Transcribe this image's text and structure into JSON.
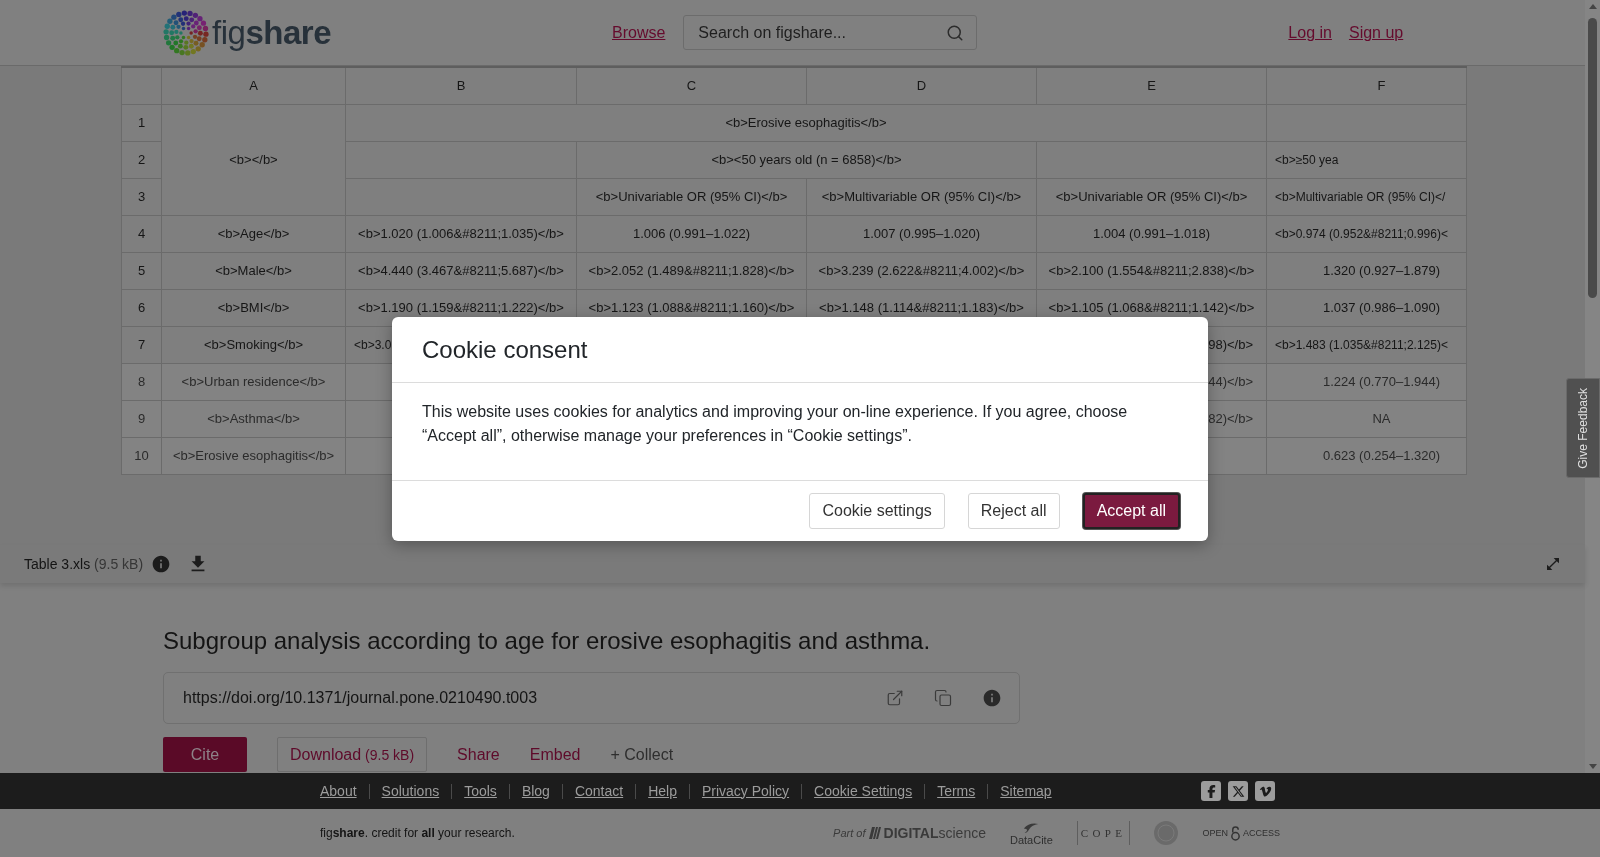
{
  "header": {
    "logo": "fig**share**",
    "nav": [
      {
        "label": "Browse"
      }
    ],
    "search": {
      "placeholder": "Search on figshare..."
    },
    "account_links": [
      {
        "label": "Log in"
      },
      {
        "label": "Sign up"
      }
    ]
  },
  "spreadsheet": {
    "columns": [
      "A",
      "B",
      "C",
      "D",
      "E",
      "F"
    ],
    "rows": [
      {
        "number": "1",
        "blurred": false,
        "cells": [
          {
            "kind": "full",
            "text": "<b></b>",
            "rowspan": 3
          },
          {
            "kind": "full",
            "text": "<b>Erosive esophagitis</b>",
            "colspan": 4
          },
          {
            "kind": "empty"
          }
        ]
      },
      {
        "number": "2",
        "blurred": false,
        "cells": [
          {
            "kind": "empty"
          },
          {
            "kind": "full",
            "text": "<b><50 years old (n = 6858)</b>",
            "colspan": 2
          },
          {
            "kind": "empty"
          },
          {
            "kind": "head",
            "text": "<b>≥50 yea"
          }
        ]
      },
      {
        "number": "3",
        "blurred": false,
        "cells": [
          {
            "kind": "empty"
          },
          {
            "kind": "full",
            "text": "<b>Univariable OR (95% CI)</b>"
          },
          {
            "kind": "full",
            "text": "<b>Multivariable OR (95% CI)</b>"
          },
          {
            "kind": "full",
            "text": "<b>Univariable OR (95% CI)</b>"
          },
          {
            "kind": "head",
            "text": "<b>Multivariable OR (95% CI)</"
          }
        ]
      },
      {
        "number": "4",
        "blurred": false,
        "cells": [
          {
            "kind": "full",
            "text": "<b>Age</b>"
          },
          {
            "kind": "full",
            "text": "<b>1.020 (1.006&#8211;1.035)</b>"
          },
          {
            "kind": "full",
            "text": "1.006 (0.991–1.022)"
          },
          {
            "kind": "full",
            "text": "1.007 (0.995–1.020)"
          },
          {
            "kind": "full",
            "text": "1.004 (0.991–1.018)"
          },
          {
            "kind": "head",
            "text": "<b>0.974 (0.952&#8211;0.996)<"
          }
        ]
      },
      {
        "number": "5",
        "blurred": false,
        "cells": [
          {
            "kind": "full",
            "text": "<b>Male</b>"
          },
          {
            "kind": "full",
            "text": "<b>4.440 (3.467&#8211;5.687)</b>"
          },
          {
            "kind": "full",
            "text": "<b>2.052 (1.489&#8211;1.828)</b>"
          },
          {
            "kind": "full",
            "text": "<b>3.239 (2.622&#8211;4.002)</b>"
          },
          {
            "kind": "full",
            "text": "<b>2.100 (1.554&#8211;2.838)</b>"
          },
          {
            "kind": "full",
            "text": "1.320 (0.927–1.879)"
          }
        ]
      },
      {
        "number": "6",
        "blurred": false,
        "cells": [
          {
            "kind": "full",
            "text": "<b>BMI</b>"
          },
          {
            "kind": "full",
            "text": "<b>1.190 (1.159&#8211;1.222)</b>"
          },
          {
            "kind": "full",
            "text": "<b>1.123 (1.088&#8211;1.160)</b>"
          },
          {
            "kind": "full",
            "text": "<b>1.148 (1.114&#8211;1.183)</b>"
          },
          {
            "kind": "full",
            "text": "<b>1.105 (1.068&#8211;1.142)</b>"
          },
          {
            "kind": "full",
            "text": "1.037 (0.986–1.090)"
          }
        ]
      },
      {
        "number": "7",
        "blurred": false,
        "cells": [
          {
            "kind": "full",
            "text": "<b>Smoking</b>"
          },
          {
            "kind": "head",
            "text": "<b>3.0"
          },
          {
            "kind": "empty"
          },
          {
            "kind": "empty"
          },
          {
            "kind": "tail",
            "text": "98)</b>"
          },
          {
            "kind": "head",
            "text": "<b>1.483 (1.035&#8211;2.125)<"
          }
        ]
      },
      {
        "number": "8",
        "blurred": true,
        "cells": [
          {
            "kind": "full",
            "text": "<b>Urban residence</b>"
          },
          {
            "kind": "empty"
          },
          {
            "kind": "empty"
          },
          {
            "kind": "empty"
          },
          {
            "kind": "tail",
            "text": "44)</b>"
          },
          {
            "kind": "full",
            "text": "1.224 (0.770–1.944)"
          }
        ]
      },
      {
        "number": "9",
        "blurred": true,
        "cells": [
          {
            "kind": "full",
            "text": "<b>Asthma</b>"
          },
          {
            "kind": "empty"
          },
          {
            "kind": "empty"
          },
          {
            "kind": "empty"
          },
          {
            "kind": "tail",
            "text": "82)</b>"
          },
          {
            "kind": "full",
            "text": "NA"
          }
        ]
      },
      {
        "number": "10",
        "blurred": true,
        "cells": [
          {
            "kind": "full",
            "text": "<b>Erosive esophagitis</b>"
          },
          {
            "kind": "empty"
          },
          {
            "kind": "empty"
          },
          {
            "kind": "empty"
          },
          {
            "kind": "empty"
          },
          {
            "kind": "full",
            "text": "0.623 (0.254–1.320)"
          }
        ]
      }
    ]
  },
  "file_bar": {
    "file_name": "Table 3.xls",
    "file_size": "(9.5 kB)"
  },
  "article": {
    "title": "Subgroup analysis according to age for erosive esophagitis and asthma.",
    "doi": "https://doi.org/10.1371/journal.pone.0210490.t003",
    "actions": [
      {
        "kind": "primary",
        "label": "Cite"
      },
      {
        "kind": "outlined",
        "label": "Download",
        "detail": "(9.5 kB)"
      },
      {
        "kind": "link",
        "label": "Share"
      },
      {
        "kind": "link",
        "label": "Embed"
      },
      {
        "kind": "muted",
        "label": "+ Collect"
      }
    ]
  },
  "footer": {
    "links": [
      "About",
      "Solutions",
      "Tools",
      "Blog",
      "Contact",
      "Help",
      "Privacy Policy",
      "Cookie Settings",
      "Terms",
      "Sitemap"
    ],
    "social": [
      {
        "kind": "facebook"
      },
      {
        "kind": "x"
      },
      {
        "kind": "vimeo"
      }
    ],
    "tagline": "fig**share**. credit for **all** your research.",
    "partners": [
      {
        "kind": "digital_science",
        "prefix": "Part of",
        "name": "**DIGITAL**science"
      },
      {
        "kind": "datacite",
        "name": "DataCite"
      },
      {
        "kind": "cope",
        "name": "COPE"
      },
      {
        "kind": "seal"
      },
      {
        "kind": "open_access",
        "words": [
          "OPEN",
          "ACCESS"
        ]
      }
    ]
  },
  "feedback_tab": {
    "label": "Give Feedback"
  },
  "cookie_dialog": {
    "title": "Cookie consent",
    "message": "This website uses cookies for analytics and improving your on-line experience. If you agree, choose “Accept all”, otherwise manage your preferences in “Cookie settings”.",
    "buttons": [
      {
        "label": "Cookie settings",
        "kind": "secondary",
        "focused": false
      },
      {
        "label": "Reject all",
        "kind": "secondary",
        "focused": false
      },
      {
        "label": "Accept all",
        "kind": "primary",
        "focused": true
      }
    ]
  }
}
